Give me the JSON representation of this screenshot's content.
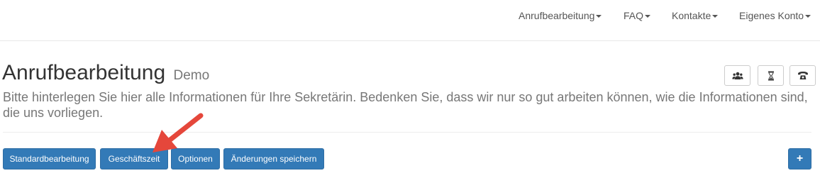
{
  "nav": {
    "items": [
      {
        "label": "Anrufbearbeitung"
      },
      {
        "label": "FAQ"
      },
      {
        "label": "Kontakte"
      },
      {
        "label": "Eigenes Konto"
      }
    ]
  },
  "header": {
    "title": "Anrufbearbeitung",
    "subtitle": "Demo",
    "icons": [
      "users-icon",
      "hourglass-icon",
      "phone-icon"
    ]
  },
  "description": "Bitte hinterlegen Sie hier alle Informationen für Ihre Sekretärin. Bedenken Sie, dass wir nur so gut arbeiten können, wie die Informationen sind, die uns vorliegen.",
  "buttons": {
    "standard": "Standardbearbeitung",
    "business_hours": "Geschäftszeit",
    "options": "Optionen",
    "save": "Änderungen speichern",
    "add": "+"
  },
  "colors": {
    "primary": "#337ab7",
    "arrow": "#e5473b"
  }
}
